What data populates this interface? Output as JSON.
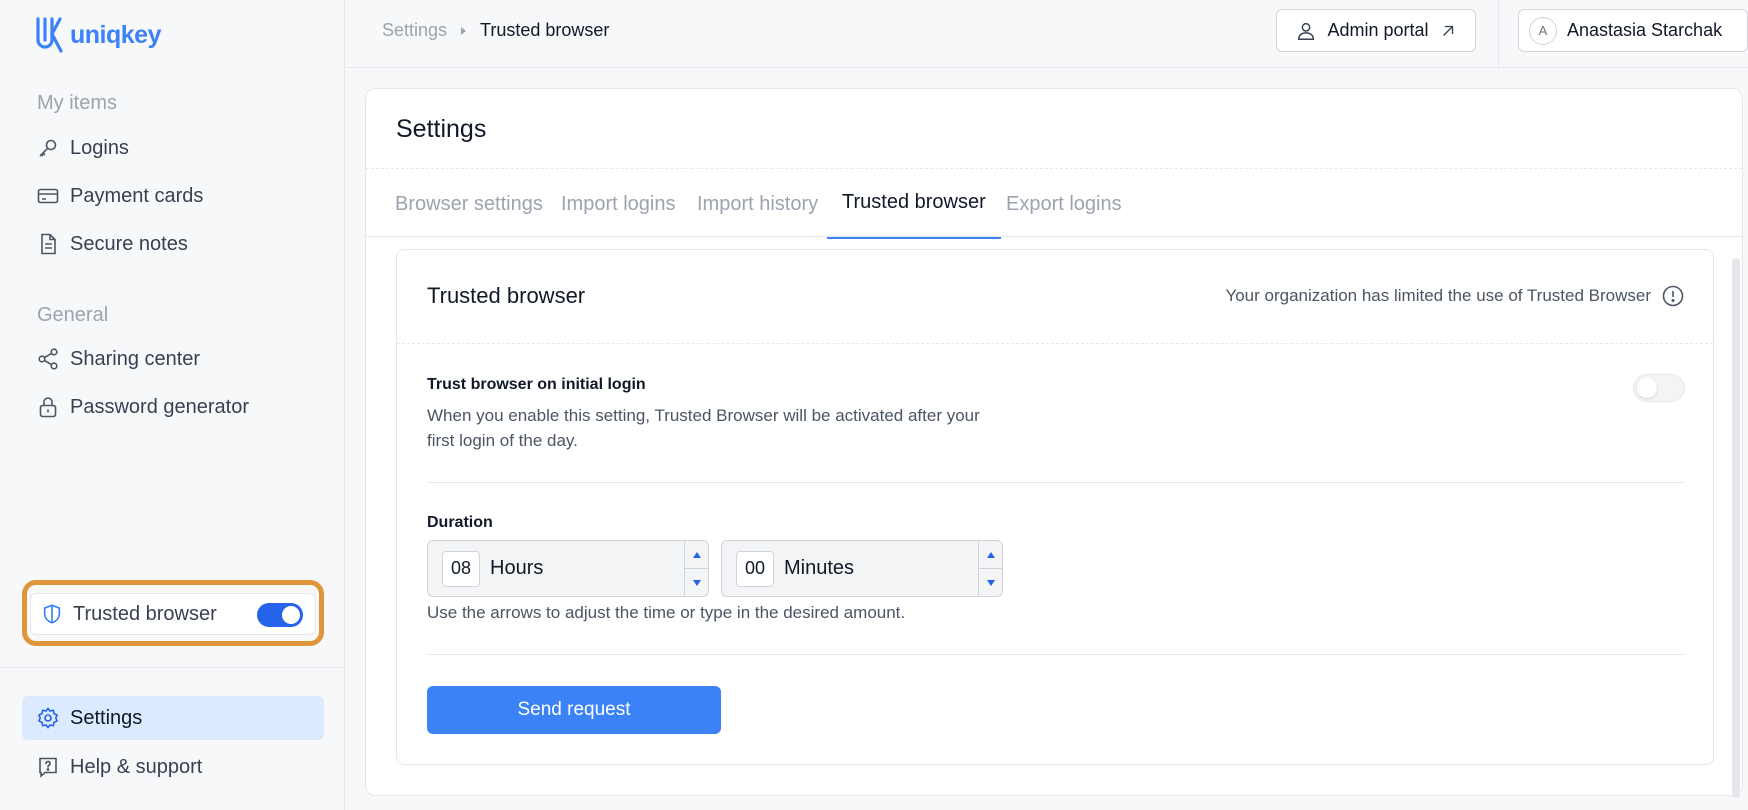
{
  "app": {
    "logo_text": "uniqkey",
    "brand_color": "#3b82f6",
    "accent_highlight": "#e0953a"
  },
  "sidebar": {
    "section_my_items": "My items",
    "items_my": [
      {
        "label": "Logins",
        "icon": "key-icon"
      },
      {
        "label": "Payment cards",
        "icon": "credit-card-icon"
      },
      {
        "label": "Secure notes",
        "icon": "document-icon"
      }
    ],
    "section_general": "General",
    "items_general": [
      {
        "label": "Sharing center",
        "icon": "share-icon"
      },
      {
        "label": "Password generator",
        "icon": "lock-icon"
      }
    ],
    "trusted_browser": {
      "label": "Trusted browser",
      "enabled": true
    },
    "bottom_items": [
      {
        "label": "Settings",
        "icon": "gear-icon",
        "active": true
      },
      {
        "label": "Help & support",
        "icon": "help-icon"
      }
    ]
  },
  "topbar": {
    "breadcrumb": [
      "Settings",
      "Trusted browser"
    ],
    "admin_portal": "Admin portal",
    "user_initial": "A",
    "user_name": "Anastasia Starchak"
  },
  "settings": {
    "title": "Settings",
    "tabs": [
      "Browser settings",
      "Import logins",
      "Import history",
      "Trusted browser",
      "Export logins"
    ],
    "active_tab": "Trusted browser"
  },
  "trusted": {
    "title": "Trusted browser",
    "org_note": "Your organization has limited the use of Trusted Browser",
    "option_title": "Trust browser on initial login",
    "option_desc": "When you enable this setting, Trusted Browser will be activated after your first login of the day.",
    "option_enabled": false,
    "duration_label": "Duration",
    "hours_value": "08",
    "hours_unit": "Hours",
    "minutes_value": "00",
    "minutes_unit": "Minutes",
    "hint": "Use the arrows to adjust the time or type in the desired amount.",
    "send_button": "Send request"
  }
}
